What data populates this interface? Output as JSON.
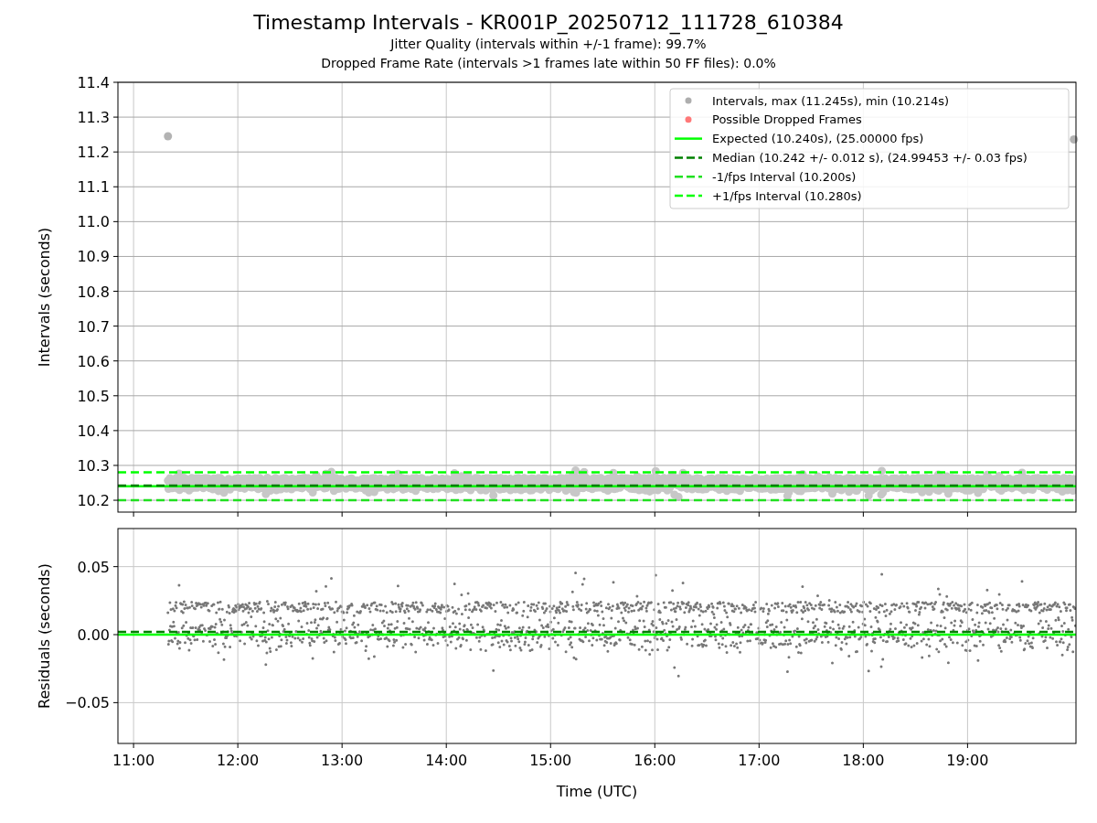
{
  "title": "Timestamp Intervals - KR001P_20250712_111728_610384",
  "subtitles": [
    "Jitter Quality (intervals within +/-1 frame): 99.7%",
    "Dropped Frame Rate (intervals >1 frames late within 50 FF files): 0.0%"
  ],
  "charts": [
    {
      "kind": "intervals",
      "chart_data": {
        "type": "scatter",
        "ylabel": "Intervals (seconds)",
        "grid": true,
        "legend": true,
        "x": [
          11.33,
          20.02
        ],
        "xlim": [
          10.85,
          20.04
        ],
        "ylim": [
          10.166,
          11.4
        ],
        "yticks": [
          {
            "value": 10.2,
            "label": "10.2"
          },
          {
            "value": 10.3,
            "label": "10.3"
          },
          {
            "value": 10.4,
            "label": "10.4"
          },
          {
            "value": 10.5,
            "label": "10.5"
          },
          {
            "value": 10.6,
            "label": "10.6"
          },
          {
            "value": 10.7,
            "label": "10.7"
          },
          {
            "value": 10.8,
            "label": "10.8"
          },
          {
            "value": 10.9,
            "label": "10.9"
          },
          {
            "value": 11.0,
            "label": "11.0"
          },
          {
            "value": 11.1,
            "label": "11.1"
          },
          {
            "value": 11.2,
            "label": "11.2"
          },
          {
            "value": 11.3,
            "label": "11.3"
          },
          {
            "value": 11.4,
            "label": "11.4"
          }
        ],
        "series": [
          {
            "name": "Intervals, max (11.245s), min (10.214s)",
            "color": "#a0a0a0",
            "marker": "o",
            "values": [
              11.245,
              11.236
            ]
          },
          {
            "name": "Possible Dropped Frames",
            "color": "#ff6060",
            "marker": "o",
            "values": [
              null,
              null
            ]
          }
        ],
        "ref_lines": [
          {
            "axis": "y",
            "value": 10.24,
            "label": "Expected (10.240s), (25.00000 fps)",
            "color": "#00ff00",
            "line_style": "solid"
          },
          {
            "axis": "y",
            "value": 10.242,
            "label": "Median (10.242 +/- 0.012 s), (24.99453 +/- 0.03 fps)",
            "color": "#008000",
            "line_style": "dashed"
          },
          {
            "axis": "y",
            "value": 10.2,
            "label": "-1/fps Interval (10.200s)",
            "color": "#20e020",
            "line_style": "dashed"
          },
          {
            "axis": "y",
            "value": 10.28,
            "label": "+1/fps Interval (10.280s)",
            "color": "#00ff00",
            "line_style": "dashed"
          }
        ]
      }
    },
    {
      "kind": "residuals",
      "chart_data": {
        "type": "scatter",
        "xlabel": "Time (UTC)",
        "ylabel": "Residuals (seconds)",
        "grid": true,
        "xlim": [
          10.85,
          20.04
        ],
        "ylim": [
          -0.08,
          0.078
        ],
        "xticks": [
          {
            "value": 11,
            "label": "11:00"
          },
          {
            "value": 12,
            "label": "12:00"
          },
          {
            "value": 13,
            "label": "13:00"
          },
          {
            "value": 14,
            "label": "14:00"
          },
          {
            "value": 15,
            "label": "15:00"
          },
          {
            "value": 16,
            "label": "16:00"
          },
          {
            "value": 17,
            "label": "17:00"
          },
          {
            "value": 18,
            "label": "18:00"
          },
          {
            "value": 19,
            "label": "19:00"
          }
        ],
        "yticks": [
          {
            "value": -0.05,
            "label": "−0.05"
          },
          {
            "value": 0,
            "label": "0.00"
          },
          {
            "value": 0.05,
            "label": "0.05"
          }
        ],
        "ref_lines": [
          {
            "axis": "y",
            "value": 0,
            "color": "#00ff00",
            "line_style": "solid"
          },
          {
            "axis": "y",
            "value": 0.002,
            "color": "#008000",
            "line_style": "dashed"
          }
        ]
      }
    }
  ]
}
